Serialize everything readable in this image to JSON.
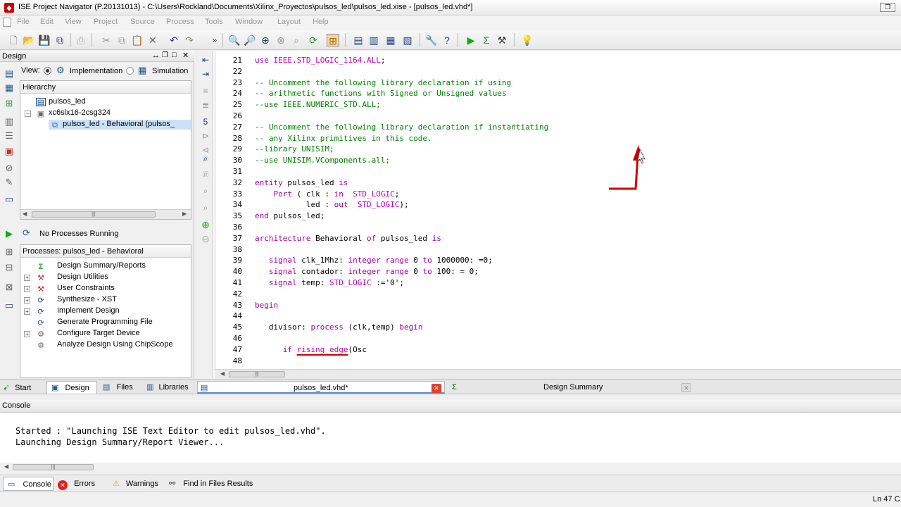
{
  "window": {
    "title": "ISE Project Navigator (P.20131013) - C:\\Users\\Rockland\\Documents\\Xilinx_Proyectos\\pulsos_led\\pulsos_led.xise - [pulsos_led.vhd*]"
  },
  "menu": [
    "File",
    "Edit",
    "View",
    "Project",
    "Source",
    "Process",
    "Tools",
    "Window",
    "Layout",
    "Help"
  ],
  "design_panel": {
    "title": "Design",
    "view_label": "View:",
    "implementation_label": "Implementation",
    "simulation_label": "Simulation",
    "hierarchy_label": "Hierarchy",
    "hierarchy_items": [
      "pulsos_led",
      "xc6slx16-2csg324",
      "pulsos_led - Behavioral (pulsos_"
    ],
    "process_status": "No Processes Running",
    "processes_header": "Processes: pulsos_led - Behavioral",
    "processes": [
      "Design Summary/Reports",
      "Design Utilities",
      "User Constraints",
      "Synthesize - XST",
      "Implement Design",
      "Generate Programming File",
      "Configure Target Device",
      "Analyze Design Using ChipScope"
    ]
  },
  "editor": {
    "lines": [
      {
        "n": "21",
        "parts": [
          [
            "kw",
            "use "
          ],
          [
            "ty",
            "IEEE.STD_LOGIC_1164.ALL"
          ],
          [
            "",
            "; "
          ]
        ]
      },
      {
        "n": "22",
        "parts": []
      },
      {
        "n": "23",
        "parts": [
          [
            "cm",
            "-- Uncomment the following library declaration if using"
          ]
        ]
      },
      {
        "n": "24",
        "parts": [
          [
            "cm",
            "-- arithmetic functions with Signed or Unsigned values"
          ]
        ]
      },
      {
        "n": "25",
        "parts": [
          [
            "cm",
            "--use IEEE.NUMERIC_STD.ALL;"
          ]
        ]
      },
      {
        "n": "26",
        "parts": []
      },
      {
        "n": "27",
        "parts": [
          [
            "cm",
            "-- Uncomment the following library declaration if instantiating"
          ]
        ]
      },
      {
        "n": "28",
        "parts": [
          [
            "cm",
            "-- any Xilinx primitives in this code."
          ]
        ]
      },
      {
        "n": "29",
        "parts": [
          [
            "cm",
            "--library UNISIM;"
          ]
        ]
      },
      {
        "n": "30",
        "parts": [
          [
            "cm",
            "--use UNISIM.VComponents.all;"
          ]
        ]
      },
      {
        "n": "31",
        "parts": []
      },
      {
        "n": "32",
        "parts": [
          [
            "kw",
            "entity "
          ],
          [
            "",
            "pulsos_led "
          ],
          [
            "kw",
            "is"
          ]
        ]
      },
      {
        "n": "33",
        "parts": [
          [
            "",
            "    "
          ],
          [
            "kw",
            "Port"
          ],
          [
            "",
            " ( clk : "
          ],
          [
            "kw",
            "in"
          ],
          [
            "",
            "  "
          ],
          [
            "ty",
            "STD_LOGIC"
          ],
          [
            "",
            ";"
          ]
        ]
      },
      {
        "n": "34",
        "parts": [
          [
            "",
            "           led : "
          ],
          [
            "kw",
            "out"
          ],
          [
            "",
            "  "
          ],
          [
            "ty",
            "STD_LOGIC"
          ],
          [
            "",
            ");"
          ]
        ]
      },
      {
        "n": "35",
        "parts": [
          [
            "kw",
            "end "
          ],
          [
            "",
            "pulsos_led;"
          ]
        ]
      },
      {
        "n": "36",
        "parts": []
      },
      {
        "n": "37",
        "parts": [
          [
            "kw",
            "architecture "
          ],
          [
            "",
            "Behavioral "
          ],
          [
            "kw",
            "of "
          ],
          [
            "",
            "pulsos_led "
          ],
          [
            "kw",
            "is"
          ]
        ]
      },
      {
        "n": "38",
        "parts": []
      },
      {
        "n": "39",
        "parts": [
          [
            "",
            "   "
          ],
          [
            "kw",
            "signal"
          ],
          [
            "",
            " clk_1Mhz: "
          ],
          [
            "kw",
            "integer range"
          ],
          [
            "",
            " 0 "
          ],
          [
            "kw",
            "to"
          ],
          [
            "",
            " 1000000: =0;"
          ]
        ]
      },
      {
        "n": "40",
        "parts": [
          [
            "",
            "   "
          ],
          [
            "kw",
            "signal"
          ],
          [
            "",
            " contador: "
          ],
          [
            "kw",
            "integer range"
          ],
          [
            "",
            " 0 "
          ],
          [
            "kw",
            "to"
          ],
          [
            "",
            " 100: = 0;"
          ]
        ]
      },
      {
        "n": "41",
        "parts": [
          [
            "",
            "   "
          ],
          [
            "kw",
            "signal"
          ],
          [
            "",
            " temp: "
          ],
          [
            "ty",
            "STD_LOGIC"
          ],
          [
            "",
            " :='0';"
          ]
        ]
      },
      {
        "n": "42",
        "parts": []
      },
      {
        "n": "43",
        "parts": [
          [
            "kw",
            "begin"
          ]
        ]
      },
      {
        "n": "44",
        "parts": []
      },
      {
        "n": "45",
        "parts": [
          [
            "",
            "   divisor: "
          ],
          [
            "kw",
            "process"
          ],
          [
            "",
            " (clk,temp) "
          ],
          [
            "kw",
            "begin"
          ]
        ]
      },
      {
        "n": "46",
        "parts": []
      },
      {
        "n": "47",
        "parts": [
          [
            "",
            "      "
          ],
          [
            "kw",
            "if "
          ],
          [
            "u",
            "rising_edge"
          ],
          [
            "",
            "(Osc"
          ]
        ]
      },
      {
        "n": "48",
        "parts": []
      }
    ]
  },
  "tabs": {
    "start": "Start",
    "design": "Design",
    "files": "Files",
    "libraries": "Libraries",
    "file_tab": "pulsos_led.vhd*",
    "summary_tab": "Design Summary"
  },
  "console": {
    "title": "Console",
    "lines": [
      "Started : \"Launching ISE Text Editor to edit pulsos_led.vhd\".",
      "Launching Design Summary/Report Viewer..."
    ],
    "tabs": [
      "Console",
      "Errors",
      "Warnings",
      "Find in Files Results"
    ]
  },
  "status": {
    "position": "Ln 47 C"
  },
  "colors": {
    "keyword": "#a000a0",
    "comment": "#008000",
    "type": "#c000c0",
    "annotation": "#d00000"
  }
}
